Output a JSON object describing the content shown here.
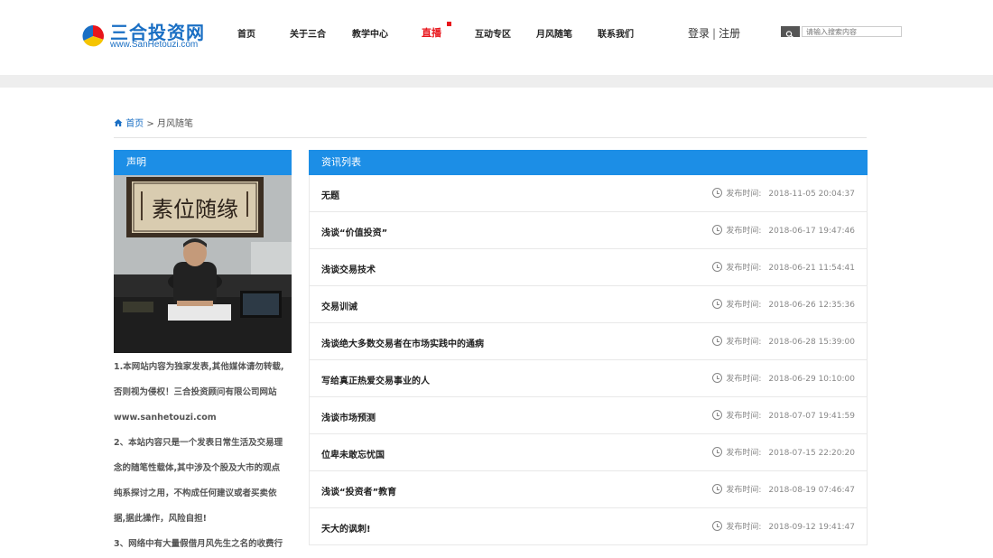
{
  "brand": {
    "name": "三合投资网",
    "url": "www.SanHetouzi.com"
  },
  "nav": [
    {
      "label": "首页"
    },
    {
      "label": "关于三合"
    },
    {
      "label": "教学中心"
    },
    {
      "label": "直播"
    },
    {
      "label": "互动专区"
    },
    {
      "label": "月风随笔"
    },
    {
      "label": "联系我们"
    }
  ],
  "auth": {
    "login": "登录",
    "sep": "|",
    "register": "注册"
  },
  "search": {
    "placeholder": "请输入搜索内容"
  },
  "breadcrumb": {
    "home": "首页",
    "sep": ">",
    "current": "月风随笔"
  },
  "sidebar": {
    "title": "声明",
    "notice_lines": [
      "1.本网站内容为独家发表,其他媒体请勿转载,",
      "否则视为侵权！三合投资顾问有限公司网站",
      "www.sanhetouzi.com",
      "2、本站内容只是一个发表日常生活及交易理",
      "念的随笔性载体,其中涉及个股及大市的观点",
      "纯系探讨之用，不构成任何建议或者买卖依",
      "据,据此操作，风险自担!",
      "3、网络中有大量假借月风先生之名的收费行"
    ]
  },
  "news": {
    "title": "资讯列表",
    "date_label": "发布时间:",
    "items": [
      {
        "title": "无题",
        "date": "2018-11-05 20:04:37"
      },
      {
        "title": "浅谈“价值投资”",
        "date": "2018-06-17 19:47:46"
      },
      {
        "title": "浅谈交易技术",
        "date": "2018-06-21 11:54:41"
      },
      {
        "title": "交易训诫",
        "date": "2018-06-26 12:35:36"
      },
      {
        "title": "浅谈绝大多数交易者在市场实践中的通病",
        "date": "2018-06-28 15:39:00"
      },
      {
        "title": "写给真正热爱交易事业的人",
        "date": "2018-06-29 10:10:00"
      },
      {
        "title": "浅谈市场预测",
        "date": "2018-07-07 19:41:59"
      },
      {
        "title": "位卑未敢忘忧国",
        "date": "2018-07-15 22:20:20"
      },
      {
        "title": "浅谈“投资者”教育",
        "date": "2018-08-19 07:46:47"
      },
      {
        "title": "天大的讽刺!",
        "date": "2018-09-12 19:41:47"
      }
    ]
  },
  "colors": {
    "accent": "#1c8ee6",
    "live": "#e8151b",
    "brand": "#1a6fc4"
  }
}
